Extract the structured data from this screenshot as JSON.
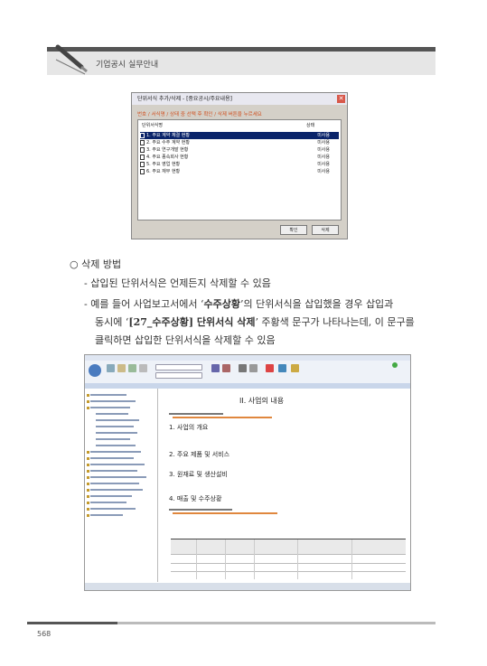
{
  "header": {
    "title": "기업공시 실무안내"
  },
  "dialog": {
    "title": "단위서식 추가/삭제 - [중요공시/주요내용]",
    "hint": "번호 / 서식명 / 상태 중 선택 후 확인 / 삭제 버튼을 누르세요",
    "col_name": "단위서식명",
    "col_status": "상태",
    "rows": [
      {
        "name": "1. 주요 계약 체결 현황",
        "status": "미사용"
      },
      {
        "name": "2. 주요 수주 계약 현황",
        "status": "미사용"
      },
      {
        "name": "3. 주요 연구개발 현황",
        "status": "미사용"
      },
      {
        "name": "4. 주요 종속회사 현황",
        "status": "미사용"
      },
      {
        "name": "5. 주요 영업 현황",
        "status": "미사용"
      },
      {
        "name": "6. 주요 재무 현황",
        "status": "미사용"
      }
    ],
    "btn_ok": "확인",
    "btn_delete": "삭제"
  },
  "section": {
    "title": "○ 삭제 방법",
    "line1": "- 삽입된 단위서식은 언제든지 삭제할 수 있음",
    "line2a": "- 예를 들어 사업보고서에서 ‘",
    "line2b": "수주상황",
    "line2c": "’의 단위서식을 삽입했을 경우 삽입과",
    "line3a": "동시에 ‘",
    "line3b": "[27_수주상황] 단위서식 삭제",
    "line3c": "’ 주황색 문구가 나타나는데, 이 문구를",
    "line4": "클릭하면 삽입한 단위서식을 삭제할 수 있음"
  },
  "editor": {
    "doc_heading1": "II. 사업의 내용",
    "doc_item1": "1. 사업의 개요",
    "doc_item2": "2. 주요 제품 및 서비스",
    "doc_item3": "3. 원재료 및 생산설비",
    "doc_item4": "4. 매출 및 수주상황"
  },
  "footer": {
    "page": "568"
  }
}
